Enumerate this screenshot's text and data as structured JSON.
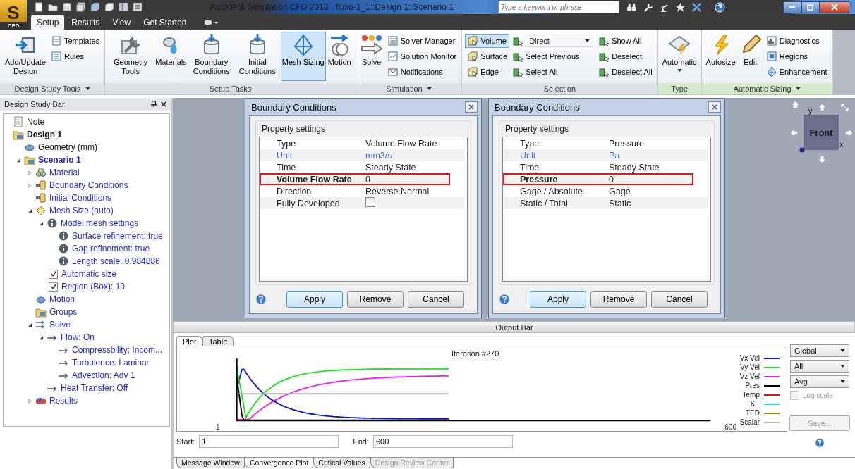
{
  "title_bar": {
    "title": "Autodesk Simulation CFD 2013   fluxo-1_1::Design 1::Scenario 1",
    "search": {
      "placeholder": "Type a keyword or phrase"
    }
  },
  "logo": {
    "letter": "S",
    "caption": "CFD"
  },
  "tabs": [
    {
      "label": "Setup",
      "selected": true
    },
    {
      "label": "Results",
      "selected": false
    },
    {
      "label": "View",
      "selected": false
    },
    {
      "label": "Get Started",
      "selected": false
    }
  ],
  "ribbon": [
    {
      "label": "Design Study Tools",
      "menu": true,
      "contextual": false,
      "items": [
        {
          "kind": "large",
          "label": "Add/Update Design",
          "selected": false
        },
        {
          "kind": "small",
          "label": "Templates",
          "selected": false
        },
        {
          "kind": "small",
          "label": "Rules",
          "selected": false
        }
      ]
    },
    {
      "label": "Setup Tasks",
      "menu": false,
      "contextual": false,
      "items": [
        {
          "kind": "large",
          "label": "Geometry Tools",
          "selected": false
        },
        {
          "kind": "large",
          "label": "Materials",
          "selected": false
        },
        {
          "kind": "large",
          "label": "Boundary Conditions",
          "selected": false
        },
        {
          "kind": "large",
          "label": "Initial Conditions",
          "selected": false
        },
        {
          "kind": "large",
          "label": "Mesh Sizing",
          "selected": true
        },
        {
          "kind": "large",
          "label": "Motion",
          "selected": false
        }
      ]
    },
    {
      "label": "Simulation",
      "menu": true,
      "contextual": false,
      "items": [
        {
          "kind": "large",
          "label": "Solve",
          "selected": false
        },
        {
          "kind": "small",
          "label": "Solver Manager",
          "selected": false
        },
        {
          "kind": "small",
          "label": "Solution Monitor",
          "selected": false
        },
        {
          "kind": "small",
          "label": "Notifications",
          "selected": false
        }
      ]
    },
    {
      "label": "Selection",
      "menu": false,
      "contextual": false,
      "items": [
        {
          "kind": "small",
          "label": "Volume",
          "selected": true
        },
        {
          "kind": "small",
          "label": "Surface",
          "selected": false
        },
        {
          "kind": "small",
          "label": "Edge",
          "selected": false
        },
        {
          "kind": "dropdown",
          "label": "Direct",
          "selected": false
        },
        {
          "kind": "small",
          "label": "Select Previous",
          "selected": false
        },
        {
          "kind": "small",
          "label": "Select All",
          "selected": false
        },
        {
          "kind": "small",
          "label": "Show All",
          "selected": false
        },
        {
          "kind": "small",
          "label": "Deselect",
          "selected": false
        },
        {
          "kind": "small",
          "label": "Deselect All",
          "selected": false
        }
      ]
    },
    {
      "label": "Type",
      "menu": false,
      "contextual": true,
      "items": [
        {
          "kind": "large-menu",
          "label": "Automatic",
          "selected": false
        }
      ]
    },
    {
      "label": "Automatic Sizing",
      "menu": true,
      "contextual": true,
      "items": [
        {
          "kind": "large",
          "label": "Autosize",
          "selected": false
        },
        {
          "kind": "large",
          "label": "Edit",
          "selected": false
        },
        {
          "kind": "small",
          "label": "Diagnostics",
          "selected": false
        },
        {
          "kind": "small",
          "label": "Regions",
          "selected": false
        },
        {
          "kind": "small",
          "label": "Enhancement",
          "selected": false
        }
      ]
    }
  ],
  "design_study_bar": {
    "title": "Design Study Bar",
    "tree": [
      {
        "kind": "note",
        "label": "Note"
      },
      {
        "kind": "design",
        "label": "Design 1",
        "children": [
          {
            "kind": "geometry",
            "label": "Geometry (mm)"
          },
          {
            "kind": "scenario",
            "label": "Scenario 1",
            "expanded": true,
            "children": [
              {
                "kind": "material",
                "label": "Material",
                "expanded": false
              },
              {
                "kind": "boundary",
                "label": "Boundary Conditions",
                "expanded": false
              },
              {
                "kind": "initial",
                "label": "Initial Conditions"
              },
              {
                "kind": "mesh",
                "label": "Mesh Size (auto)",
                "expanded": true,
                "children": [
                  {
                    "kind": "info",
                    "label": "Model mesh settings",
                    "expanded": true,
                    "children": [
                      {
                        "kind": "info",
                        "label": "Surface refinement: true"
                      },
                      {
                        "kind": "info",
                        "label": "Gap refinement: true"
                      },
                      {
                        "kind": "info",
                        "label": "Length scale: 0.984886"
                      }
                    ]
                  },
                  {
                    "kind": "check",
                    "label": "Automatic size",
                    "checked": true
                  },
                  {
                    "kind": "check",
                    "label": "Region (Box): 10",
                    "checked": true
                  }
                ]
              },
              {
                "kind": "motion",
                "label": "Motion"
              },
              {
                "kind": "groups",
                "label": "Groups"
              },
              {
                "kind": "solve",
                "label": "Solve",
                "expanded": true,
                "children": [
                  {
                    "kind": "flow",
                    "label": "Flow: On",
                    "expanded": true,
                    "children": [
                      {
                        "kind": "flow",
                        "label": "Compressbility: Incom..."
                      },
                      {
                        "kind": "flow",
                        "label": "Turbulence: Laminar"
                      },
                      {
                        "kind": "flow",
                        "label": "Advection: Adv 1"
                      }
                    ]
                  },
                  {
                    "kind": "flow",
                    "label": "Heat Transfer: Off"
                  }
                ]
              },
              {
                "kind": "results",
                "label": "Results",
                "expanded": false
              }
            ]
          }
        ]
      }
    ]
  },
  "dialogs": [
    {
      "title": "Boundary Conditions",
      "section": "Property settings",
      "rows": [
        {
          "kind": "text",
          "name": "Type",
          "value": "Volume Flow Rate",
          "highlighted": false
        },
        {
          "kind": "unit",
          "name": "Unit",
          "value": "mm3/s",
          "highlighted": false
        },
        {
          "kind": "text",
          "name": "Time",
          "value": "Steady State",
          "highlighted": false
        },
        {
          "kind": "text",
          "name": "Volume Flow Rate",
          "value": "0",
          "highlighted": true
        },
        {
          "kind": "text",
          "name": "Direction",
          "value": "Reverse Normal",
          "highlighted": false
        },
        {
          "kind": "checkbox",
          "name": "Fully Developed",
          "checked": false,
          "highlighted": false
        }
      ],
      "buttons": [
        {
          "label": "Apply",
          "focused": true
        },
        {
          "label": "Remove",
          "focused": false
        },
        {
          "label": "Cancel",
          "focused": false
        }
      ]
    },
    {
      "title": "Boundary Conditions",
      "section": "Property settings",
      "rows": [
        {
          "kind": "text",
          "name": "Type",
          "value": "Pressure",
          "highlighted": false
        },
        {
          "kind": "unit",
          "name": "Unit",
          "value": "Pa",
          "highlighted": false
        },
        {
          "kind": "text",
          "name": "Time",
          "value": "Steady State",
          "highlighted": false
        },
        {
          "kind": "text",
          "name": "Pressure",
          "value": "0",
          "highlighted": true
        },
        {
          "kind": "text",
          "name": "Gage / Absolute",
          "value": "Gage",
          "highlighted": false
        },
        {
          "kind": "text",
          "name": "Static / Total",
          "value": "Static",
          "highlighted": false
        }
      ],
      "buttons": [
        {
          "label": "Apply",
          "focused": true
        },
        {
          "label": "Remove",
          "focused": false
        },
        {
          "label": "Cancel",
          "focused": false
        }
      ]
    }
  ],
  "view_cube": {
    "face": "Front",
    "y_label": "y",
    "x_label": "x"
  },
  "output_bar": {
    "title": "Output Bar",
    "tabs": [
      {
        "label": "Plot",
        "selected": true
      },
      {
        "label": "Table",
        "selected": false
      }
    ],
    "plot": {
      "iteration": "Iteration #270",
      "x_start": "1",
      "x_end": "600",
      "legend": [
        {
          "name": "Vx Vel",
          "color": "#1414c8"
        },
        {
          "name": "Vy Vel",
          "color": "#22e022"
        },
        {
          "name": "Vz Vel",
          "color": "#f020f0"
        },
        {
          "name": "Pres",
          "color": "#000000"
        },
        {
          "name": "Temp",
          "color": "#e01010"
        },
        {
          "name": "TKE",
          "color": "#22e0f0"
        },
        {
          "name": "TED",
          "color": "#808000"
        },
        {
          "name": "Scalar",
          "color": "#b4b4b4"
        }
      ]
    },
    "dropdowns": [
      "Global",
      "All",
      "Avg"
    ],
    "log_scale": {
      "label": "Log scale",
      "checked": false,
      "disabled": true
    },
    "save": {
      "label": "Save...",
      "disabled": true
    },
    "start": {
      "label": "Start:",
      "value": "1"
    },
    "end": {
      "label": "End:",
      "value": "600"
    },
    "bottom_tabs": [
      {
        "label": "Message Window",
        "selected": false,
        "disabled": false
      },
      {
        "label": "Convergence Plot",
        "selected": true,
        "disabled": false
      },
      {
        "label": "Critical Values",
        "selected": false,
        "disabled": false
      },
      {
        "label": "Design Review Center",
        "selected": false,
        "disabled": true
      }
    ]
  }
}
